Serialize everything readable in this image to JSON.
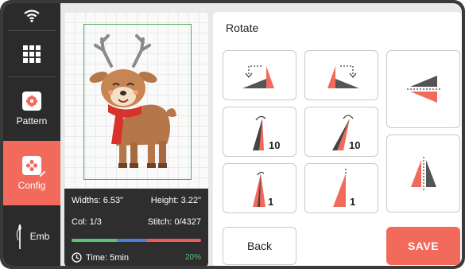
{
  "sidebar": {
    "items": [
      {
        "label": "",
        "icon": "wifi-icon"
      },
      {
        "label": "",
        "icon": "grid-menu-icon"
      },
      {
        "label": "Pattern",
        "icon": "pattern-icon"
      },
      {
        "label": "Config",
        "icon": "config-edit-icon",
        "active": true
      },
      {
        "label": "Emb",
        "icon": "needle-icon"
      }
    ]
  },
  "preview": {
    "image": "reindeer-embroidery",
    "widths": "Widths: 6.53\"",
    "height": "Height: 3.22\"",
    "col": "Col: 1/3",
    "stitch": "Stitch: 0/4327",
    "time": "Time: 5min",
    "progress": "20%"
  },
  "panel": {
    "title": "Rotate",
    "buttons": [
      {
        "name": "rotate-left-90",
        "icon": "rotate-left-90-icon",
        "label": ""
      },
      {
        "name": "rotate-right-90",
        "icon": "rotate-right-90-icon",
        "label": ""
      },
      {
        "name": "flip-vertical",
        "icon": "flip-vertical-icon",
        "label": ""
      },
      {
        "name": "rotate-left-10",
        "icon": "rotate-left-10-icon",
        "label": "10"
      },
      {
        "name": "rotate-right-10",
        "icon": "rotate-right-10-icon",
        "label": "10"
      },
      {
        "name": "flip-horizontal",
        "icon": "flip-horizontal-icon",
        "label": ""
      },
      {
        "name": "rotate-left-1",
        "icon": "rotate-left-1-icon",
        "label": "1"
      },
      {
        "name": "rotate-right-1",
        "icon": "rotate-right-1-icon",
        "label": "1"
      }
    ],
    "back_label": "Back",
    "save_label": "SAVE"
  },
  "colors": {
    "accent": "#f26a5b",
    "sidebar": "#2b2b2b",
    "hoop": "#4caf50"
  }
}
